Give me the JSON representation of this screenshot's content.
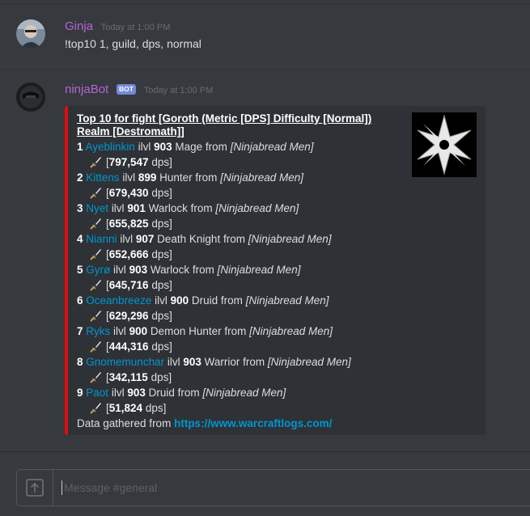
{
  "messages": [
    {
      "author": "Ginja",
      "author_color": "#b565d6",
      "timestamp": "Today at 1:00 PM",
      "text": "!top10 1, guild, dps, normal"
    },
    {
      "author": "ninjaBot",
      "author_color": "#b565d6",
      "bot_tag": "BOT",
      "timestamp": "Today at 1:00 PM",
      "embed": {
        "accent_color": "#e30d0d",
        "title": "Top 10 for fight [Goroth (Metric [DPS] Difficulty [Normal]) Realm [Destromath]]",
        "rows": [
          {
            "rank": "1",
            "player": "Ayeblinkin",
            "ilvl_label": "ilvl",
            "ilvl": "903",
            "class": "Mage from",
            "guild": "[Ninjabread Men]",
            "value": "797,547",
            "unit": "dps]"
          },
          {
            "rank": "2",
            "player": "Kittens",
            "ilvl_label": "ilvl",
            "ilvl": "899",
            "class": "Hunter from",
            "guild": "[Ninjabread Men]",
            "value": "679,430",
            "unit": "dps]"
          },
          {
            "rank": "3",
            "player": "Nyet",
            "ilvl_label": "ilvl",
            "ilvl": "901",
            "class": "Warlock from",
            "guild": "[Ninjabread Men]",
            "value": "655,825",
            "unit": "dps]"
          },
          {
            "rank": "4",
            "player": "Nianni",
            "ilvl_label": "ilvl",
            "ilvl": "907",
            "class": "Death Knight from",
            "guild": "[Ninjabread Men]",
            "value": "652,666",
            "unit": "dps]"
          },
          {
            "rank": "5",
            "player": "Gyrø",
            "ilvl_label": "ilvl",
            "ilvl": "903",
            "class": "Warlock from",
            "guild": "[Ninjabread Men]",
            "value": "645,716",
            "unit": "dps]"
          },
          {
            "rank": "6",
            "player": "Oceanbreeze",
            "ilvl_label": "ilvl",
            "ilvl": "900",
            "class": "Druid from",
            "guild": "[Ninjabread Men]",
            "value": "629,296",
            "unit": "dps]"
          },
          {
            "rank": "7",
            "player": "Ryks",
            "ilvl_label": "ilvl",
            "ilvl": "900",
            "class": "Demon Hunter from",
            "guild": "[Ninjabread Men]",
            "value": "444,316",
            "unit": "dps]"
          },
          {
            "rank": "8",
            "player": "Gnomemunchar",
            "ilvl_label": "ilvl",
            "ilvl": "903",
            "class": "Warrior from",
            "guild": "[Ninjabread Men]",
            "value": "342,115",
            "unit": "dps]"
          },
          {
            "rank": "9",
            "player": "Paot",
            "ilvl_label": "ilvl",
            "ilvl": "903",
            "class": "Druid from",
            "guild": "[Ninjabread Men]",
            "value": "51,824",
            "unit": "dps]"
          }
        ],
        "footer_text": "Data gathered from",
        "footer_link": "https://www.warcraftlogs.com/"
      }
    }
  ],
  "composer": {
    "placeholder": "Message #general"
  },
  "icons": {
    "upload": "upload-arrow-icon",
    "sword": "sword-icon",
    "thumbnail": "shuriken-logo"
  }
}
